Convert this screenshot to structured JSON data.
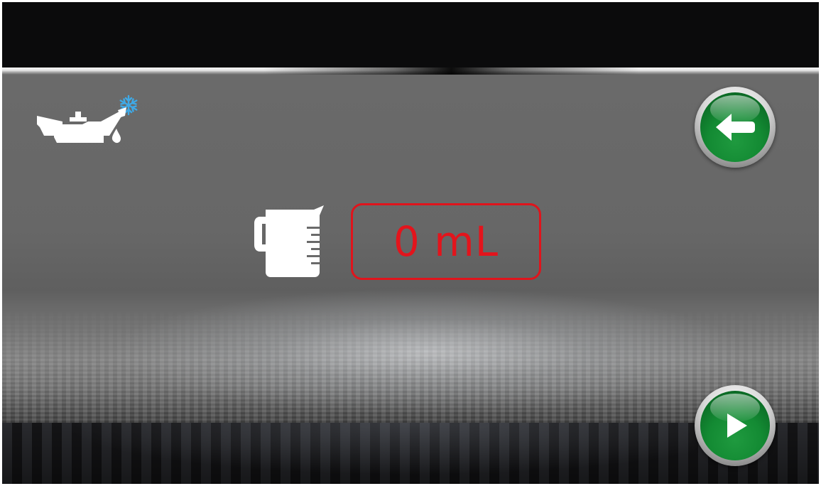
{
  "measurement": {
    "value_text": "0 mL"
  },
  "icons": {
    "status": "oil-can-with-snowflake-icon",
    "measure": "measuring-jug-icon",
    "back": "arrow-left-icon",
    "next": "play-icon"
  },
  "colors": {
    "value_red": "#e3141c",
    "button_green": "#138a33",
    "snowflake_blue": "#3fa9e6",
    "icon_white": "#ffffff"
  }
}
